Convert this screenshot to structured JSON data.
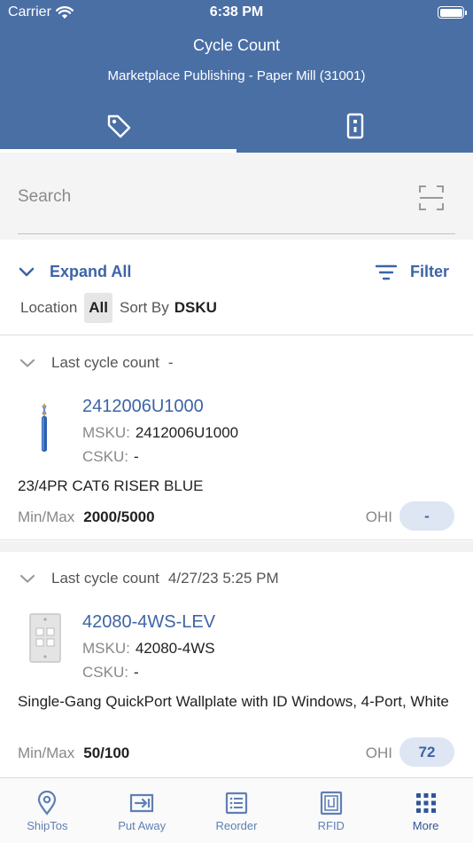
{
  "status_bar": {
    "carrier": "Carrier",
    "time": "6:38 PM"
  },
  "header": {
    "title": "Cycle Count",
    "subtitle": "Marketplace Publishing - Paper Mill (31001)",
    "tabs": [
      {
        "icon": "tag-icon"
      },
      {
        "icon": "remote-device-icon"
      }
    ],
    "active_tab": 0
  },
  "search": {
    "placeholder": "Search",
    "value": ""
  },
  "controls": {
    "expand_all": "Expand All",
    "filter": "Filter",
    "location_label": "Location",
    "location_value": "All",
    "sort_label": "Sort By",
    "sort_value": "DSKU"
  },
  "items": [
    {
      "last_cycle_label": "Last cycle count",
      "last_cycle_value": "-",
      "name": "2412006U1000",
      "msku_label": "MSKU:",
      "msku": "2412006U1000",
      "csku_label": "CSKU:",
      "csku": "-",
      "description": "23/4PR CAT6 RISER BLUE",
      "minmax_label": "Min/Max",
      "minmax": "2000/5000",
      "ohi_label": "OHI",
      "ohi": "-"
    },
    {
      "last_cycle_label": "Last cycle count",
      "last_cycle_value": "4/27/23 5:25 PM",
      "name": "42080-4WS-LEV",
      "msku_label": "MSKU:",
      "msku": "42080-4WS",
      "csku_label": "CSKU:",
      "csku": "-",
      "description": "Single-Gang QuickPort Wallplate with ID Windows, 4-Port, White",
      "minmax_label": "Min/Max",
      "minmax": "50/100",
      "ohi_label": "OHI",
      "ohi": "72"
    }
  ],
  "bottom_nav": [
    {
      "label": "ShipTos",
      "icon": "location-pin-icon"
    },
    {
      "label": "Put Away",
      "icon": "put-away-icon"
    },
    {
      "label": "Reorder",
      "icon": "list-icon"
    },
    {
      "label": "RFID",
      "icon": "rfid-icon"
    },
    {
      "label": "More",
      "icon": "grid-icon"
    }
  ],
  "colors": {
    "header": "#4a6fa5",
    "accent": "#3d64a6",
    "pill": "#dde6f2"
  }
}
